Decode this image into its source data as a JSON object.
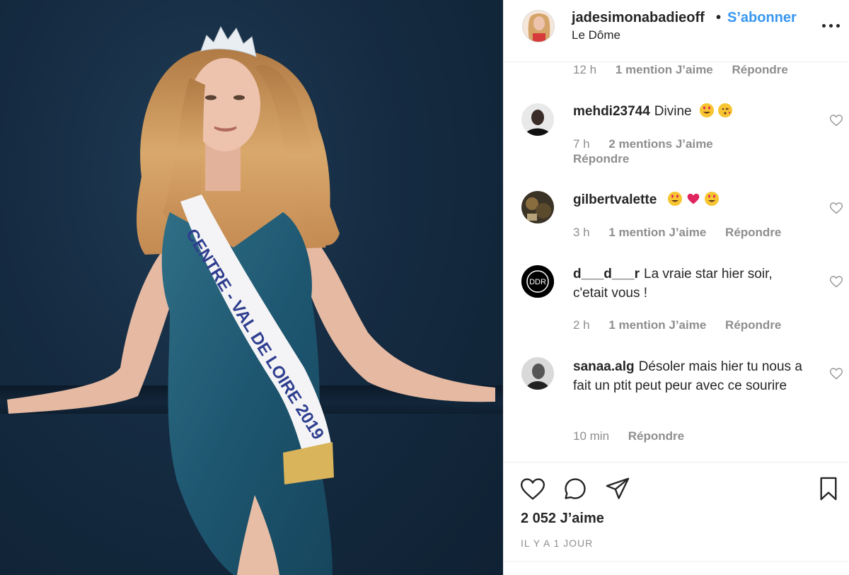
{
  "post": {
    "image_alt": "Woman in blue dress with crown and sash",
    "sash_text": "CENTRE - VAL DE LOIRE 2019"
  },
  "header": {
    "username": "jadesimonabadieoff",
    "dot": "•",
    "follow_label": "S’abonner",
    "location": "Le Dôme"
  },
  "comments": {
    "top_meta": {
      "time": "12 h",
      "likes": "1 mention J’aime",
      "reply": "Répondre"
    },
    "items": [
      {
        "username": "mehdi23744",
        "text": "Divine",
        "emojis": [
          "heart-eyes-emoji",
          "kiss-emoji"
        ],
        "time": "7 h",
        "likes": "2 mentions J’aime",
        "reply": "Répondre"
      },
      {
        "username": "gilbertvalette",
        "text": "",
        "emojis": [
          "heart-eyes-emoji",
          "red-heart-emoji",
          "heart-eyes-emoji"
        ],
        "time": "3 h",
        "likes": "1 mention J’aime",
        "reply": "Répondre"
      },
      {
        "username": "d___d___r",
        "text": "La vraie star hier soir, c'etait vous !",
        "avatar_text": "DDR",
        "time": "2 h",
        "likes": "1 mention J’aime",
        "reply": "Répondre"
      },
      {
        "username": "sanaa.alg",
        "text": "Désoler mais hier tu nous a fait un ptit peut peur avec ce sourire",
        "time": "10 min",
        "reply": "Répondre"
      }
    ]
  },
  "actions": {
    "likes_count": "2 052 J’aime",
    "posted_time": "IL Y A 1 JOUR"
  },
  "colors": {
    "accent": "#3897f0",
    "text": "#262626",
    "muted": "#8e8e8e",
    "border": "#efefef"
  }
}
